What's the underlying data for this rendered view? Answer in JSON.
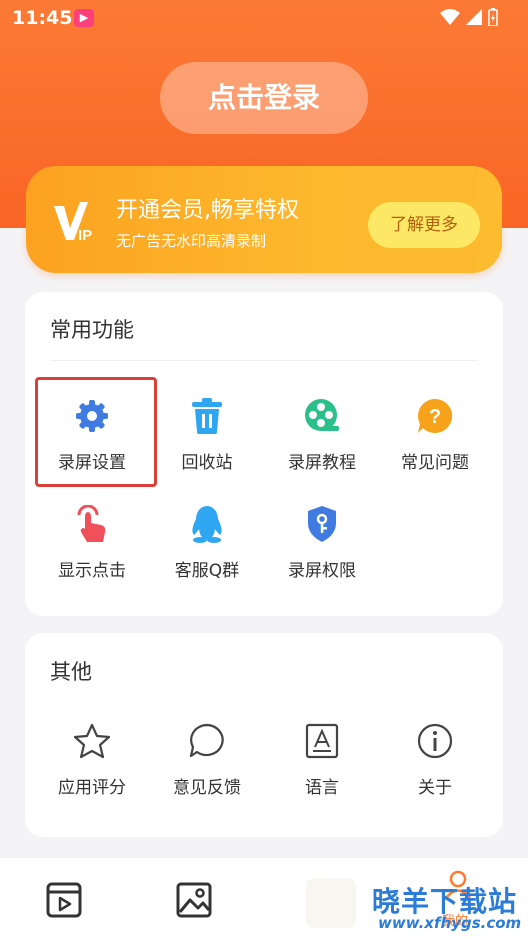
{
  "status_bar": {
    "time": "11:45",
    "app_badge": "▶"
  },
  "header": {
    "login_label": "点击登录"
  },
  "vip": {
    "logo_text": "VIP",
    "title": "开通会员,畅享特权",
    "subtitle": "无广告无水印高清录制",
    "button_label": "了解更多"
  },
  "common": {
    "title": "常用功能",
    "items": [
      {
        "label": "录屏设置",
        "icon": "gear-icon",
        "color": "#3f7be0"
      },
      {
        "label": "回收站",
        "icon": "trash-icon",
        "color": "#2fa6f2"
      },
      {
        "label": "录屏教程",
        "icon": "film-reel-icon",
        "color": "#2bbf8c"
      },
      {
        "label": "常见问题",
        "icon": "question-bubble-icon",
        "color": "#f7a21b"
      },
      {
        "label": "显示点击",
        "icon": "tap-hand-icon",
        "color": "#f0505a"
      },
      {
        "label": "客服Q群",
        "icon": "qq-penguin-icon",
        "color": "#2fa6f2"
      },
      {
        "label": "录屏权限",
        "icon": "key-shield-icon",
        "color": "#3f7be0"
      }
    ]
  },
  "others": {
    "title": "其他",
    "items": [
      {
        "label": "应用评分",
        "icon": "star-icon"
      },
      {
        "label": "意见反馈",
        "icon": "chat-bubble-icon"
      },
      {
        "label": "语言",
        "icon": "language-icon"
      },
      {
        "label": "关于",
        "icon": "info-icon"
      }
    ]
  },
  "tabbar": {
    "tabs": [
      {
        "icon": "video-tab-icon"
      },
      {
        "icon": "image-tab-icon"
      },
      {
        "icon": "profile-tab-icon",
        "label": "我的"
      }
    ]
  },
  "watermark": {
    "text": "晓羊下载站",
    "url": "www.xfhygs.com"
  },
  "colors": {
    "accent": "#fa6526",
    "vip": "#fdb82c",
    "selection": "#d9403a"
  }
}
